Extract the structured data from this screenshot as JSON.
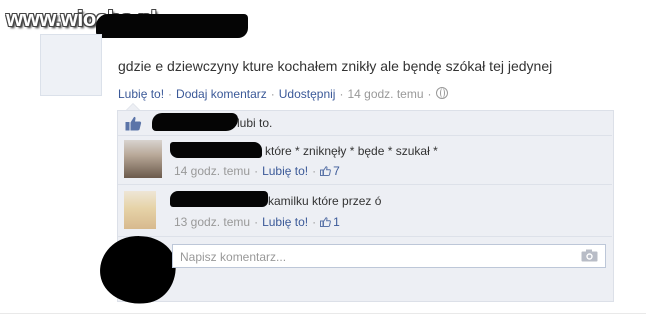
{
  "watermark": "www.wiocha.pl",
  "post": {
    "text": "gdzie e dziewczyny kture kochałem znikły ale bęndę szókał tej jedynej",
    "actions": {
      "like": "Lubię to!",
      "comment": "Dodaj komentarz",
      "share": "Udostępnij",
      "time": "14 godz. temu"
    }
  },
  "likes": {
    "text": "lubi to."
  },
  "comments": [
    {
      "text": "które * zniknęły * będe * szukał *",
      "time": "14 godz. temu",
      "like": "Lubię to!",
      "like_count": "7"
    },
    {
      "text": "kamilku które przez ó",
      "time": "13 godz. temu",
      "like": "Lubię to!",
      "like_count": "1"
    }
  ],
  "composer": {
    "placeholder": "Napisz komentarz..."
  },
  "colors": {
    "link": "#3b5998",
    "meta": "#999999",
    "panel": "#edeff4"
  },
  "icons": [
    "thumbs-up-icon",
    "globe-icon",
    "camera-icon"
  ]
}
